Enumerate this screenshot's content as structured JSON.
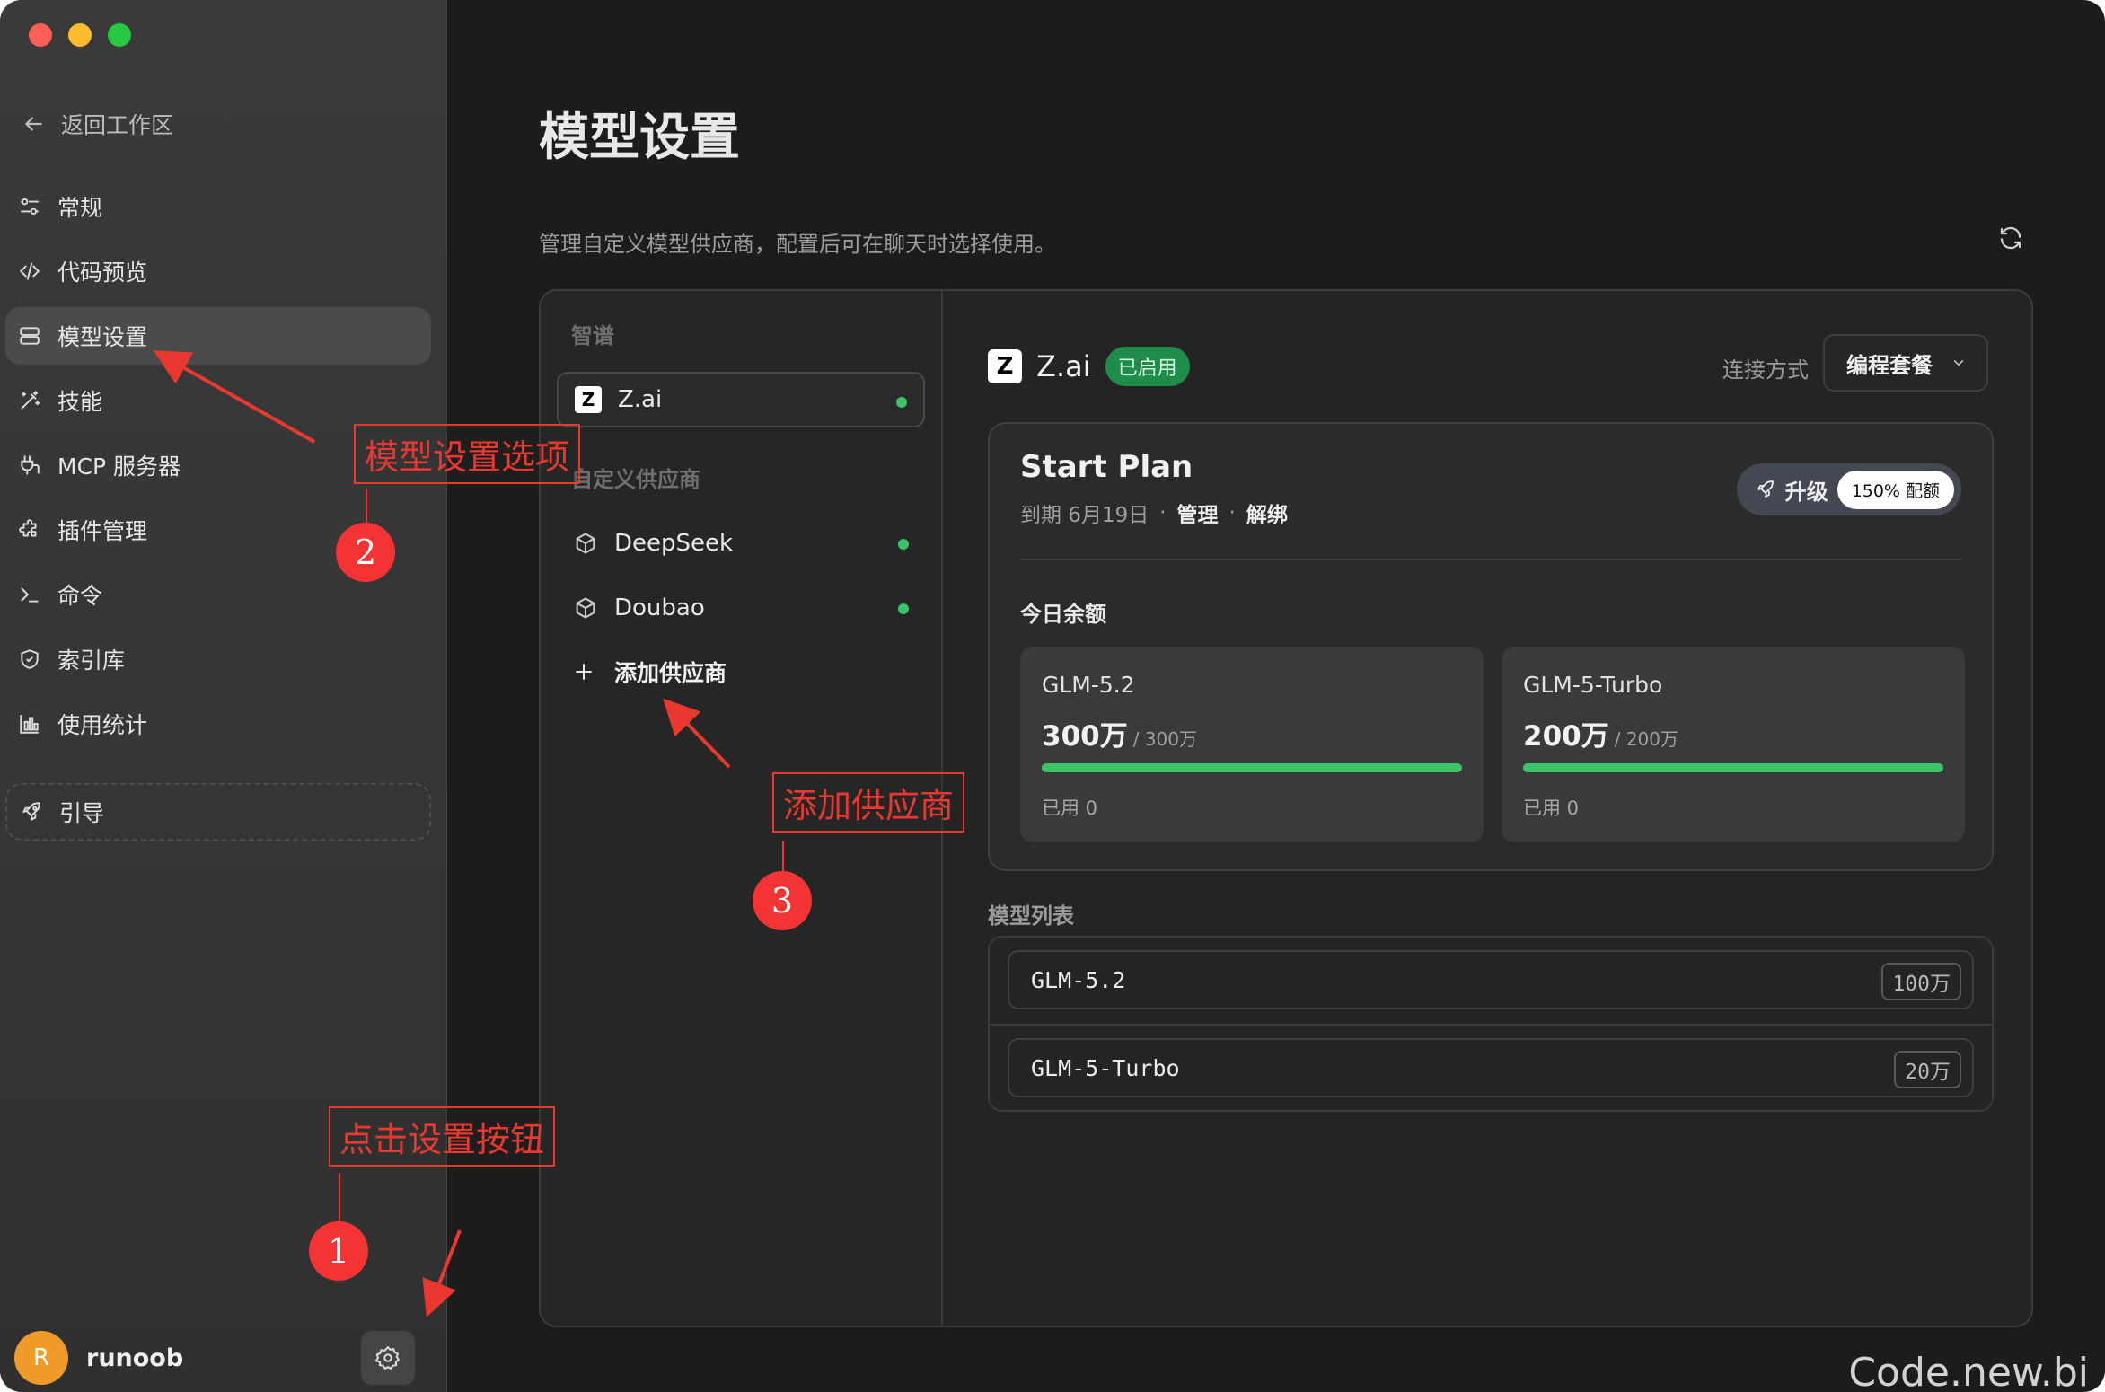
{
  "window": {
    "traffic_lights": [
      "#fe5f57",
      "#febc2e",
      "#28c840"
    ]
  },
  "sidebar": {
    "back_label": "返回工作区",
    "items": [
      {
        "label": "常规",
        "icon": "sliders-icon"
      },
      {
        "label": "代码预览",
        "icon": "code-icon"
      },
      {
        "label": "模型设置",
        "icon": "server-icon",
        "active": true
      },
      {
        "label": "技能",
        "icon": "magic-wand-icon"
      },
      {
        "label": "MCP 服务器",
        "icon": "plug-icon"
      },
      {
        "label": "插件管理",
        "icon": "puzzle-icon"
      },
      {
        "label": "命令",
        "icon": "terminal-icon"
      },
      {
        "label": "索引库",
        "icon": "shield-icon"
      },
      {
        "label": "使用统计",
        "icon": "bar-chart-icon"
      }
    ],
    "guide_label": "引导",
    "user": {
      "initial": "R",
      "name": "runoob",
      "avatar_color": "#f09a2a"
    }
  },
  "main": {
    "title": "模型设置",
    "description": "管理自定义模型供应商，配置后可在聊天时选择使用。"
  },
  "providers": {
    "group_zhipu": "智谱",
    "zhipu_items": [
      {
        "name": "Z.ai",
        "enabled": true
      }
    ],
    "group_custom": "自定义供应商",
    "custom_items": [
      {
        "name": "DeepSeek",
        "enabled": true
      },
      {
        "name": "Doubao",
        "enabled": true
      }
    ],
    "add_label": "添加供应商"
  },
  "detail": {
    "logo_letter": "Z",
    "provider_name": "Z.ai",
    "status_badge": "已启用",
    "connection_label": "连接方式",
    "connection_value": "编程套餐",
    "plan": {
      "name": "Start Plan",
      "expiry": "到期 6月19日",
      "separator": "·",
      "manage_label": "管理",
      "unbind_label": "解绑",
      "upgrade_label": "升级",
      "promo_label": "150% 配额"
    },
    "balance_title": "今日余额",
    "quotas": [
      {
        "model": "GLM-5.2",
        "remaining": "300万",
        "total": "/ 300万",
        "used": "已用 0",
        "fill": 1.0
      },
      {
        "model": "GLM-5-Turbo",
        "remaining": "200万",
        "total": "/ 200万",
        "used": "已用 0",
        "fill": 1.0
      }
    ],
    "model_list_title": "模型列表",
    "models": [
      {
        "name": "GLM-5.2",
        "context": "100万"
      },
      {
        "name": "GLM-5-Turbo",
        "context": "20万"
      }
    ]
  },
  "annotations": {
    "callout_1": "点击设置按钮",
    "callout_2": "模型设置选项",
    "callout_3": "添加供应商",
    "num_1": "1",
    "num_2": "2",
    "num_3": "3",
    "color": "#e8382f"
  },
  "watermark": "Code.new.bi"
}
